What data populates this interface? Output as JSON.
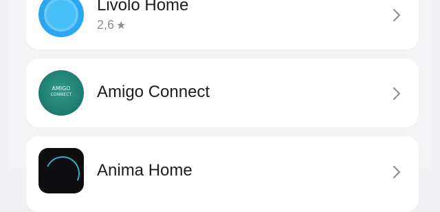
{
  "apps": [
    {
      "name": "Livolo Home",
      "rating": "2,6",
      "rating_icon": "star-icon",
      "icon": "livolo-app-icon",
      "chevron_icon": "chevron-right-icon"
    },
    {
      "name": "Amigo Connect",
      "icon": "amigo-connect-app-icon",
      "icon_text_top": "AMIGO",
      "icon_text_bottom": "CONNECT",
      "chevron_icon": "chevron-right-icon"
    },
    {
      "name": "Anima Home",
      "icon": "anima-app-icon",
      "chevron_icon": "chevron-right-icon"
    }
  ],
  "colors": {
    "background": "#f4f4f7",
    "card": "#ffffff",
    "title_text": "#1c1c1e",
    "secondary_text": "#8e8e96",
    "chevron": "#8f8f96"
  }
}
